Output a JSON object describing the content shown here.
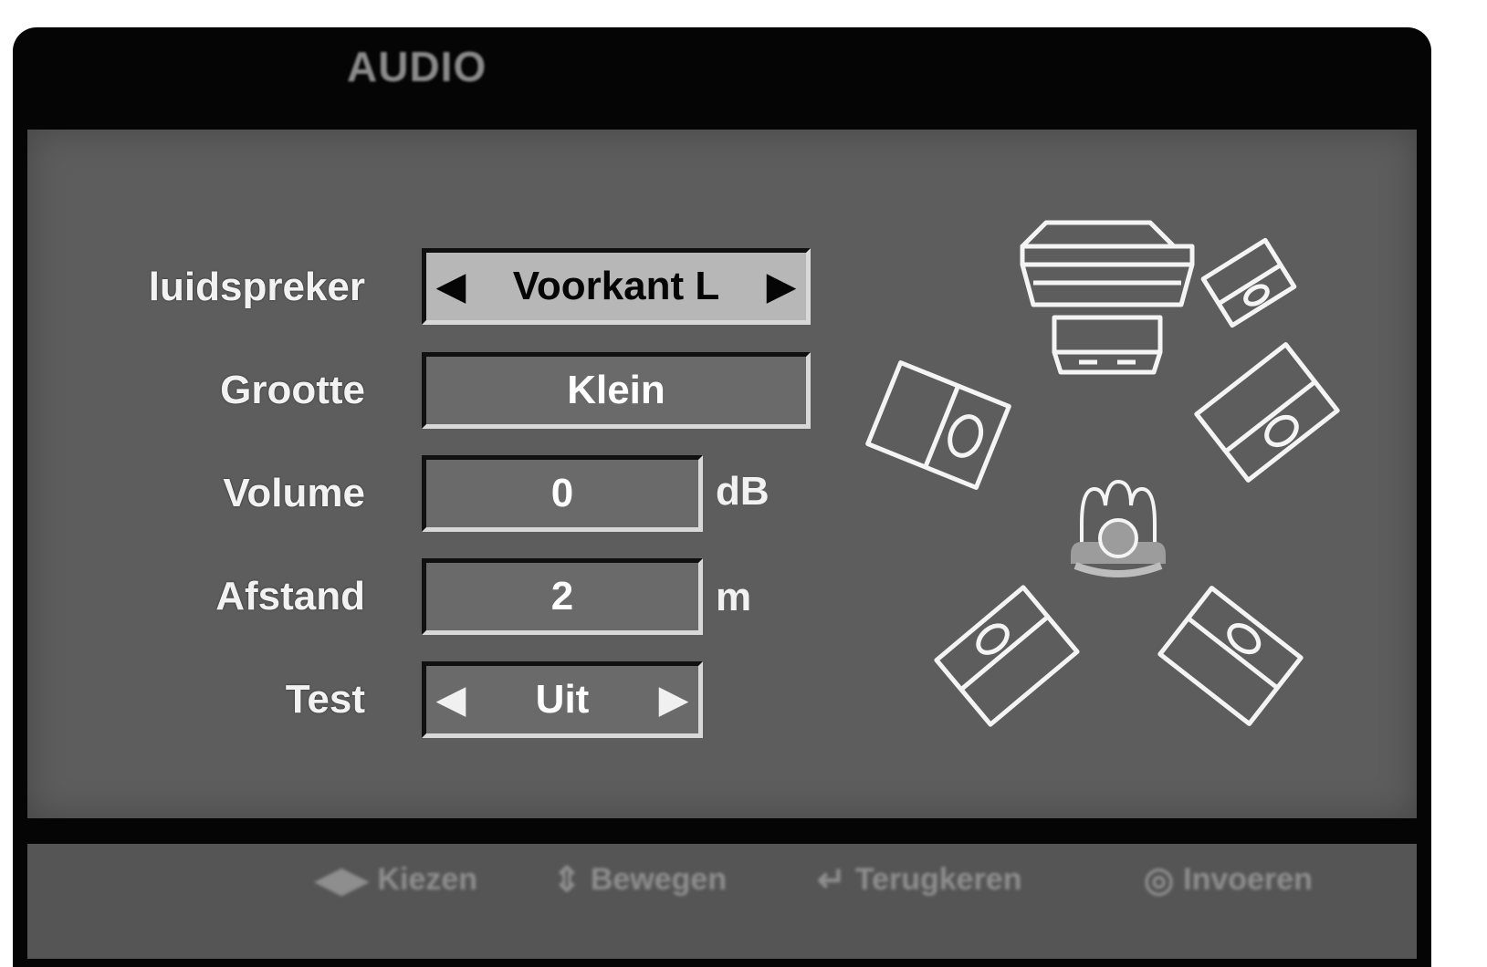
{
  "title": "AUDIO",
  "rows": {
    "speaker": {
      "label": "luidspreker",
      "value": "Voorkant L"
    },
    "size": {
      "label": "Grootte",
      "value": "Klein"
    },
    "volume": {
      "label": "Volume",
      "value": "0",
      "unit": "dB"
    },
    "distance": {
      "label": "Afstand",
      "value": "2",
      "unit": "m"
    },
    "test": {
      "label": "Test",
      "value": "Uit"
    }
  },
  "footer": {
    "select": {
      "icon": "left-right-arrows-icon",
      "label": "Kiezen"
    },
    "move": {
      "icon": "up-down-arrows-icon",
      "label": "Bewegen"
    },
    "back": {
      "icon": "return-icon",
      "label": "Terugkeren"
    },
    "store": {
      "icon": "enter-button-icon",
      "label": "Invoeren"
    }
  },
  "colors": {
    "frame": "#050505",
    "panel": "#5d5d5d",
    "selected_field": "#b7b7b7",
    "text": "#f2f2f2"
  }
}
